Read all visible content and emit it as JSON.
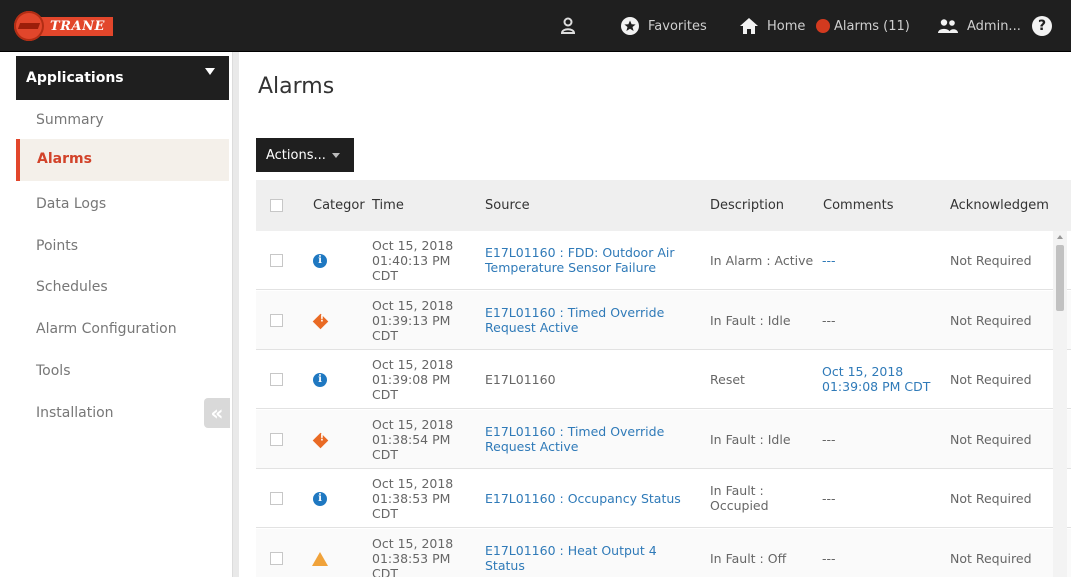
{
  "brand": {
    "name": "TRANE"
  },
  "topnav": {
    "favorites": "Favorites",
    "home": "Home",
    "alarms": "Alarms (11)",
    "admin": "Admin...",
    "help": "?"
  },
  "sidebar": {
    "header": "Applications",
    "items": [
      {
        "label": "Summary"
      },
      {
        "label": "Alarms"
      },
      {
        "label": "Data Logs"
      },
      {
        "label": "Points"
      },
      {
        "label": "Schedules"
      },
      {
        "label": "Alarm Configuration"
      },
      {
        "label": "Tools"
      },
      {
        "label": "Installation"
      }
    ],
    "active": "Alarms",
    "collapse": "«"
  },
  "page": {
    "title": "Alarms",
    "actions_label": "Actions..."
  },
  "table": {
    "headers": {
      "category": "Categor",
      "time": "Time",
      "source": "Source",
      "description": "Description",
      "comments": "Comments",
      "acknowledgement": "Acknowledgem"
    },
    "rows": [
      {
        "category": "info",
        "time": [
          "Oct 15, 2018",
          "01:40:13 PM",
          "CDT"
        ],
        "source": [
          "E17L01160 : FDD: Outdoor Air",
          "Temperature Sensor Failure"
        ],
        "source_link": true,
        "description": [
          "In Alarm : Active"
        ],
        "comments": [
          "---"
        ],
        "comments_link": true,
        "ack": "Not Required"
      },
      {
        "category": "fault",
        "time": [
          "Oct 15, 2018",
          "01:39:13 PM",
          "CDT"
        ],
        "source": [
          "E17L01160 : Timed Override",
          "Request Active"
        ],
        "source_link": true,
        "description": [
          "In Fault : Idle"
        ],
        "comments": [
          "---"
        ],
        "comments_link": false,
        "ack": "Not Required"
      },
      {
        "category": "info",
        "time": [
          "Oct 15, 2018",
          "01:39:08 PM",
          "CDT"
        ],
        "source": [
          "E17L01160"
        ],
        "source_link": false,
        "description": [
          "Reset"
        ],
        "comments": [
          "Oct 15, 2018",
          "01:39:08 PM CDT"
        ],
        "comments_link": true,
        "ack": "Not Required"
      },
      {
        "category": "fault",
        "time": [
          "Oct 15, 2018",
          "01:38:54 PM",
          "CDT"
        ],
        "source": [
          "E17L01160 : Timed Override",
          "Request Active"
        ],
        "source_link": true,
        "description": [
          "In Fault : Idle"
        ],
        "comments": [
          "---"
        ],
        "comments_link": false,
        "ack": "Not Required"
      },
      {
        "category": "info",
        "time": [
          "Oct 15, 2018",
          "01:38:53 PM",
          "CDT"
        ],
        "source": [
          "E17L01160 : Occupancy Status"
        ],
        "source_link": true,
        "description": [
          "In Fault :",
          "Occupied"
        ],
        "comments": [
          "---"
        ],
        "comments_link": false,
        "ack": "Not Required"
      },
      {
        "category": "warning",
        "time": [
          "Oct 15, 2018",
          "01:38:53 PM",
          "CDT"
        ],
        "source": [
          "E17L01160 : Heat Output 4",
          "Status"
        ],
        "source_link": true,
        "description": [
          "In Fault : Off"
        ],
        "comments": [
          "---"
        ],
        "comments_link": false,
        "ack": "Not Required"
      }
    ]
  },
  "colors": {
    "brand_red": "#e2462b",
    "topbar": "#1f1f1f",
    "link": "#2f7ab8",
    "info": "#1f78c1",
    "fault": "#e96a24",
    "warning": "#f0a23a"
  }
}
